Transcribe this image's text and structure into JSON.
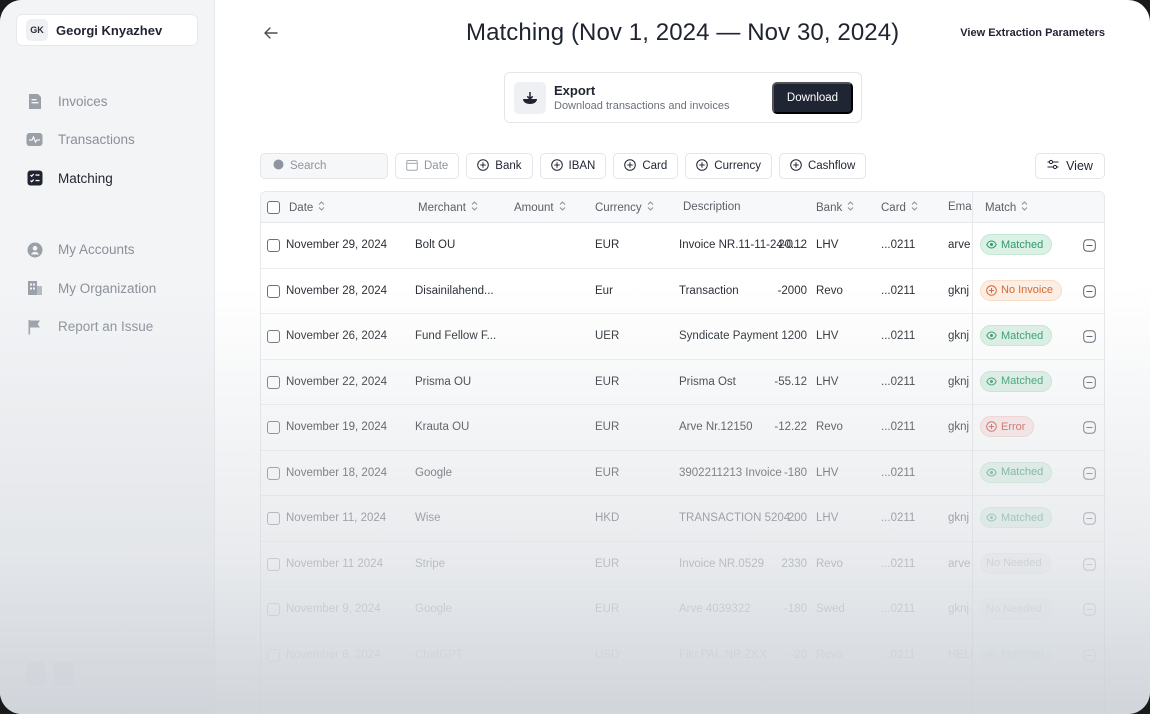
{
  "user": {
    "initials": "GK",
    "name": "Georgi Knyazhev"
  },
  "sidebar": {
    "items": [
      {
        "label": "Invoices",
        "icon": "invoice-icon"
      },
      {
        "label": "Transactions",
        "icon": "transactions-icon"
      },
      {
        "label": "Matching",
        "icon": "matching-icon",
        "active": true
      },
      {
        "label": "My Accounts",
        "icon": "account-icon"
      },
      {
        "label": "My Organization",
        "icon": "organization-icon"
      },
      {
        "label": "Report an Issue",
        "icon": "flag-icon"
      }
    ]
  },
  "header": {
    "title": "Matching (Nov 1, 2024 — Nov 30, 2024)",
    "view_params_label": "View Extraction Parameters"
  },
  "export": {
    "title": "Export",
    "subtitle": "Download transactions and invoices",
    "button_label": "Download"
  },
  "filters": {
    "search_placeholder": "Search",
    "date_label": "Date",
    "chips": [
      "Bank",
      "IBAN",
      "Card",
      "Currency",
      "Cashflow"
    ],
    "view_label": "View"
  },
  "table": {
    "columns": [
      "Date",
      "Merchant",
      "Amount",
      "Currency",
      "Description",
      "Bank",
      "Card",
      "Email",
      "Match"
    ],
    "rows": [
      {
        "date": "November 29, 2024",
        "merchant": "Bolt OÜ",
        "amount": "20.12",
        "currency": "EUR",
        "description": "Invoice NR.11-11-24-0...",
        "bank": "LHV",
        "card": "...0211",
        "email": "arve",
        "match": "Matched",
        "status": "matched"
      },
      {
        "date": "November 28, 2024",
        "merchant": "Disainilahend...",
        "amount": "-2000",
        "currency": "Eur",
        "description": "Transaction",
        "bank": "Revo",
        "card": "...0211",
        "email": "gknj",
        "match": "No Invoice",
        "status": "noinvoice"
      },
      {
        "date": "November 26, 2024",
        "merchant": "Fund Fellow F...",
        "amount": "1200",
        "currency": "UER",
        "description": "Syndicate Payment",
        "bank": "LHV",
        "card": "...0211",
        "email": "gknj",
        "match": "Matched",
        "status": "matched"
      },
      {
        "date": "November 22, 2024",
        "merchant": "Prisma OÜ",
        "amount": "-55.12",
        "currency": "EUR",
        "description": "Prisma Ost",
        "bank": "LHV",
        "card": "...0211",
        "email": "gknj",
        "match": "Matched",
        "status": "matched"
      },
      {
        "date": "November 19, 2024",
        "merchant": "Krauta OÜ",
        "amount": "-12.22",
        "currency": "EUR",
        "description": "Arve Nr.12150",
        "bank": "Revo",
        "card": "...0211",
        "email": "gknj",
        "match": "Error",
        "status": "error"
      },
      {
        "date": "November 18, 2024",
        "merchant": "Google",
        "amount": "-180",
        "currency": "EUR",
        "description": "3902211213 Invoice",
        "bank": "LHV",
        "card": "...0211",
        "email": "",
        "match": "Matched",
        "status": "matched"
      },
      {
        "date": "November 11, 2024",
        "merchant": "Wise",
        "amount": "200",
        "currency": "HKD",
        "description": "TRANSACTION 5204...",
        "bank": "LHV",
        "card": "...0211",
        "email": "gknj",
        "match": "Matched",
        "status": "matched"
      },
      {
        "date": "November 11 2024",
        "merchant": "Stripe",
        "amount": "2330",
        "currency": "EUR",
        "description": "Invoice NR.0529",
        "bank": "Revo",
        "card": "...0211",
        "email": "arve",
        "match": "No Needed",
        "status": "notneeded"
      },
      {
        "date": "November 9, 2024",
        "merchant": "Google",
        "amount": "-180",
        "currency": "EUR",
        "description": "Arve 4039322",
        "bank": "Swed",
        "card": "...0211",
        "email": "gknj",
        "match": "No Needed",
        "status": "notneeded"
      },
      {
        "date": "November 6, 2024",
        "merchant": "ChatGPT",
        "amount": "-20",
        "currency": "USD",
        "description": "Fikr.PAL.NR.ZKX",
        "bank": "Revo",
        "card": "...0211",
        "email": "HELL",
        "match": "Matched",
        "status": "matched"
      }
    ]
  },
  "colors": {
    "primary_button": "#1f2532",
    "matched": "#2f9a68",
    "no_invoice": "#d26a34",
    "error": "#cf4b41"
  }
}
